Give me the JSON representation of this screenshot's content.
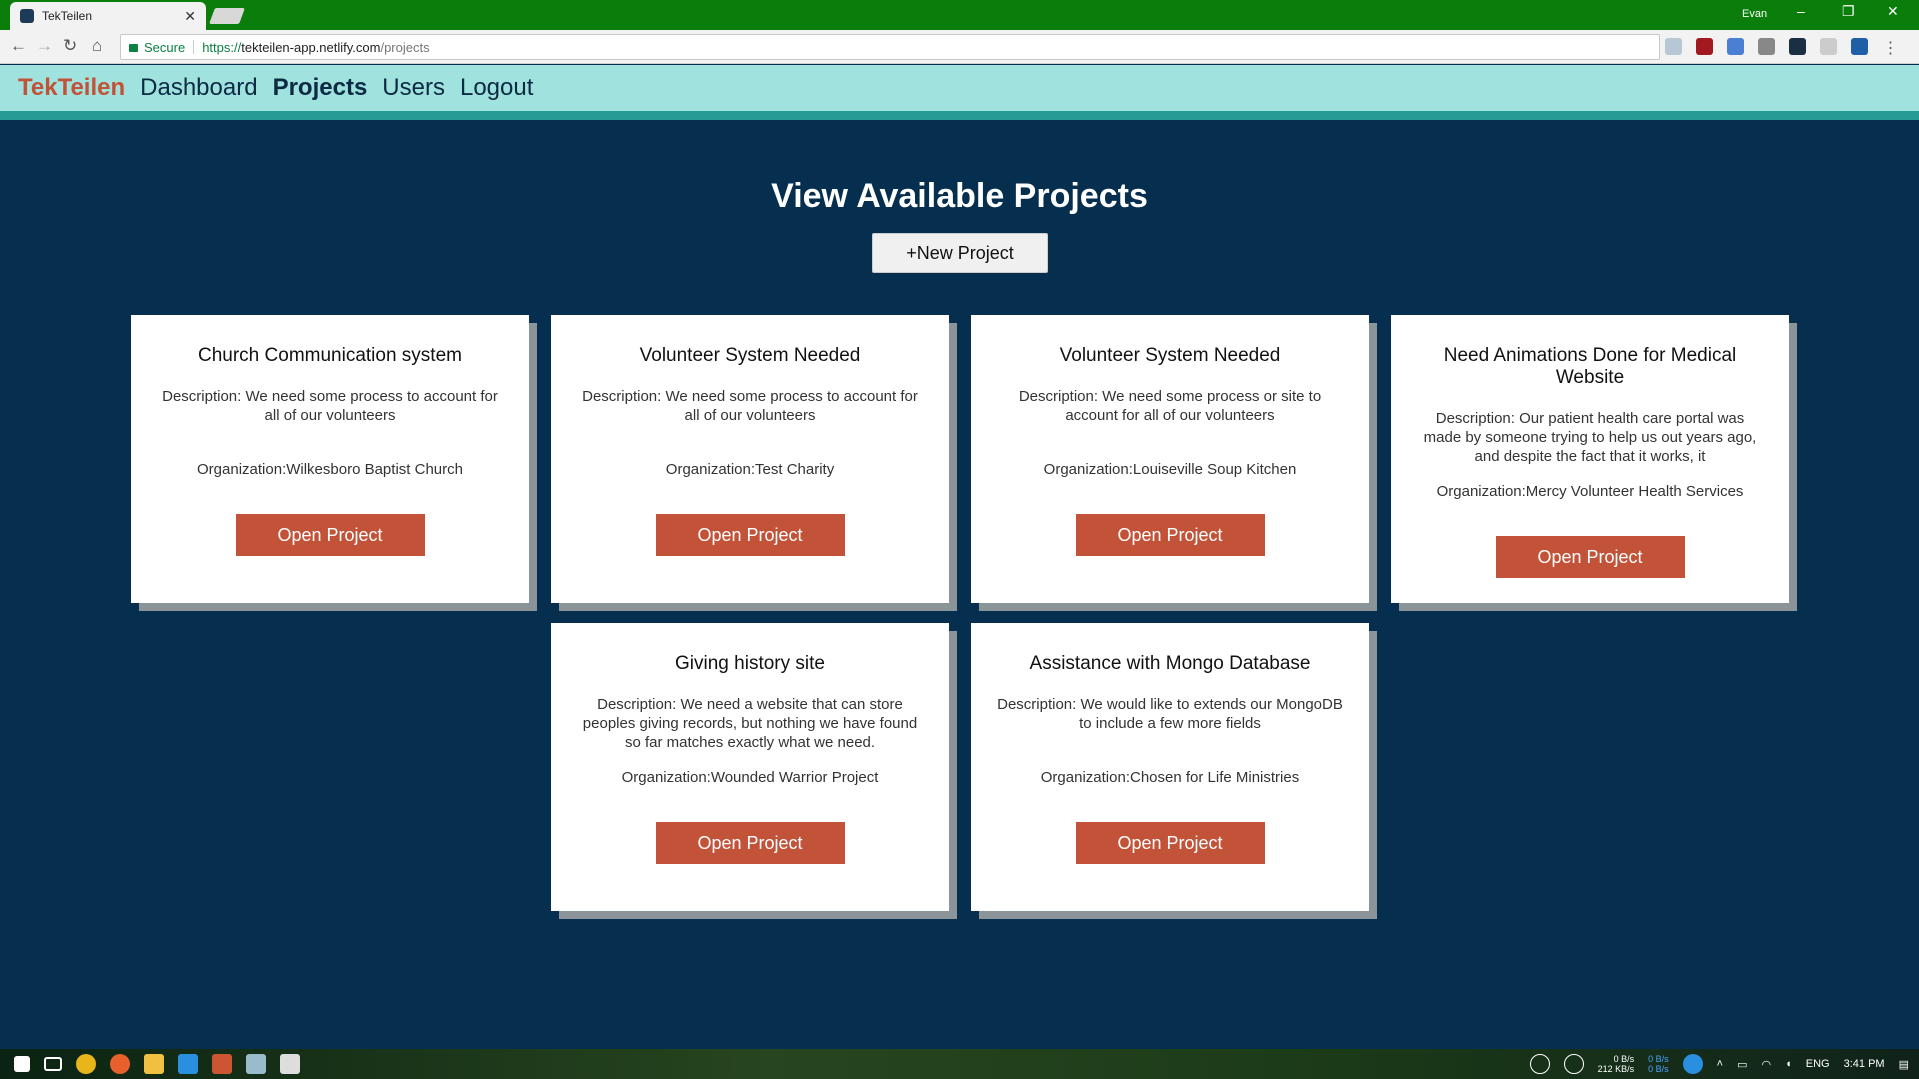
{
  "browser": {
    "tab_title": "TekTeilen",
    "profile": "Evan",
    "secure_label": "Secure",
    "url_scheme": "https://",
    "url_host": "tekteilen-app.netlify.com",
    "url_path": "/projects"
  },
  "nav": {
    "brand": "TekTeilen",
    "links": [
      {
        "label": "Dashboard",
        "active": false
      },
      {
        "label": "Projects",
        "active": true
      },
      {
        "label": "Users",
        "active": false
      },
      {
        "label": "Logout",
        "active": false
      }
    ]
  },
  "main": {
    "heading": "View Available Projects",
    "new_project_label": "+New Project",
    "projects": [
      {
        "title": "Church Communication system",
        "description": "Description: We need some process to account for all of our volunteers",
        "organization": "Organization:Wilkesboro Baptist Church",
        "button": "Open Project"
      },
      {
        "title": "Volunteer System Needed",
        "description": "Description: We need some process to account for all of our volunteers",
        "organization": "Organization:Test Charity",
        "button": "Open Project"
      },
      {
        "title": "Volunteer System Needed",
        "description": "Description: We need some process or site to account for all of our volunteers",
        "organization": "Organization:Louiseville Soup Kitchen",
        "button": "Open Project"
      },
      {
        "title": "Need Animations Done for Medical Website",
        "description": "Description: Our patient health care portal was made by someone trying to help us out years ago, and despite the fact that it works, it",
        "organization": "Organization:Mercy Volunteer Health Services",
        "button": "Open Project"
      },
      {
        "title": "Giving history site",
        "description": "Description: We need a website that can store peoples giving records, but nothing we have found so far matches exactly what we need.",
        "organization": "Organization:Wounded Warrior Project",
        "button": "Open Project"
      },
      {
        "title": "Assistance with Mongo Database",
        "description": "Description: We would like to extends our MongoDB to include a few more fields",
        "organization": "Organization:Chosen for Life Ministries",
        "button": "Open Project"
      }
    ]
  },
  "taskbar": {
    "net_up": "0 B/s",
    "net_down": "212 KB/s",
    "net_alt_up": "0 B/s",
    "net_alt_down": "0 B/s",
    "language": "ENG",
    "time": "3:41 PM"
  }
}
